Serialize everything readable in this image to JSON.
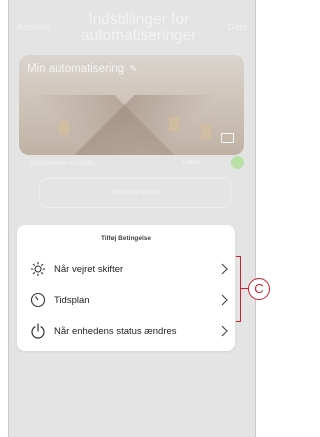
{
  "header": {
    "cancel_label": "Annullér",
    "title": "Indstillinger for automatiseringer",
    "save_label": "Gem"
  },
  "automation_card": {
    "name": "Min automatisering"
  },
  "conditions": {
    "label": "Betingelserne er opfyldt",
    "right_label": "Udført",
    "add_button_label": "Tilføj Betingelsen"
  },
  "add_condition_sheet": {
    "title": "Tilføj Betingelse",
    "options": [
      {
        "label": "Når vejret skifter",
        "icon": "weather-sun-icon"
      },
      {
        "label": "Tidsplan",
        "icon": "clock-icon"
      },
      {
        "label": "Når enhedens status ændres",
        "icon": "power-icon"
      }
    ]
  },
  "callout": {
    "label": "C",
    "color": "#d02030"
  },
  "colors": {
    "overlay": "#e4e4e4",
    "toggle_on": "#b9e0a6"
  }
}
